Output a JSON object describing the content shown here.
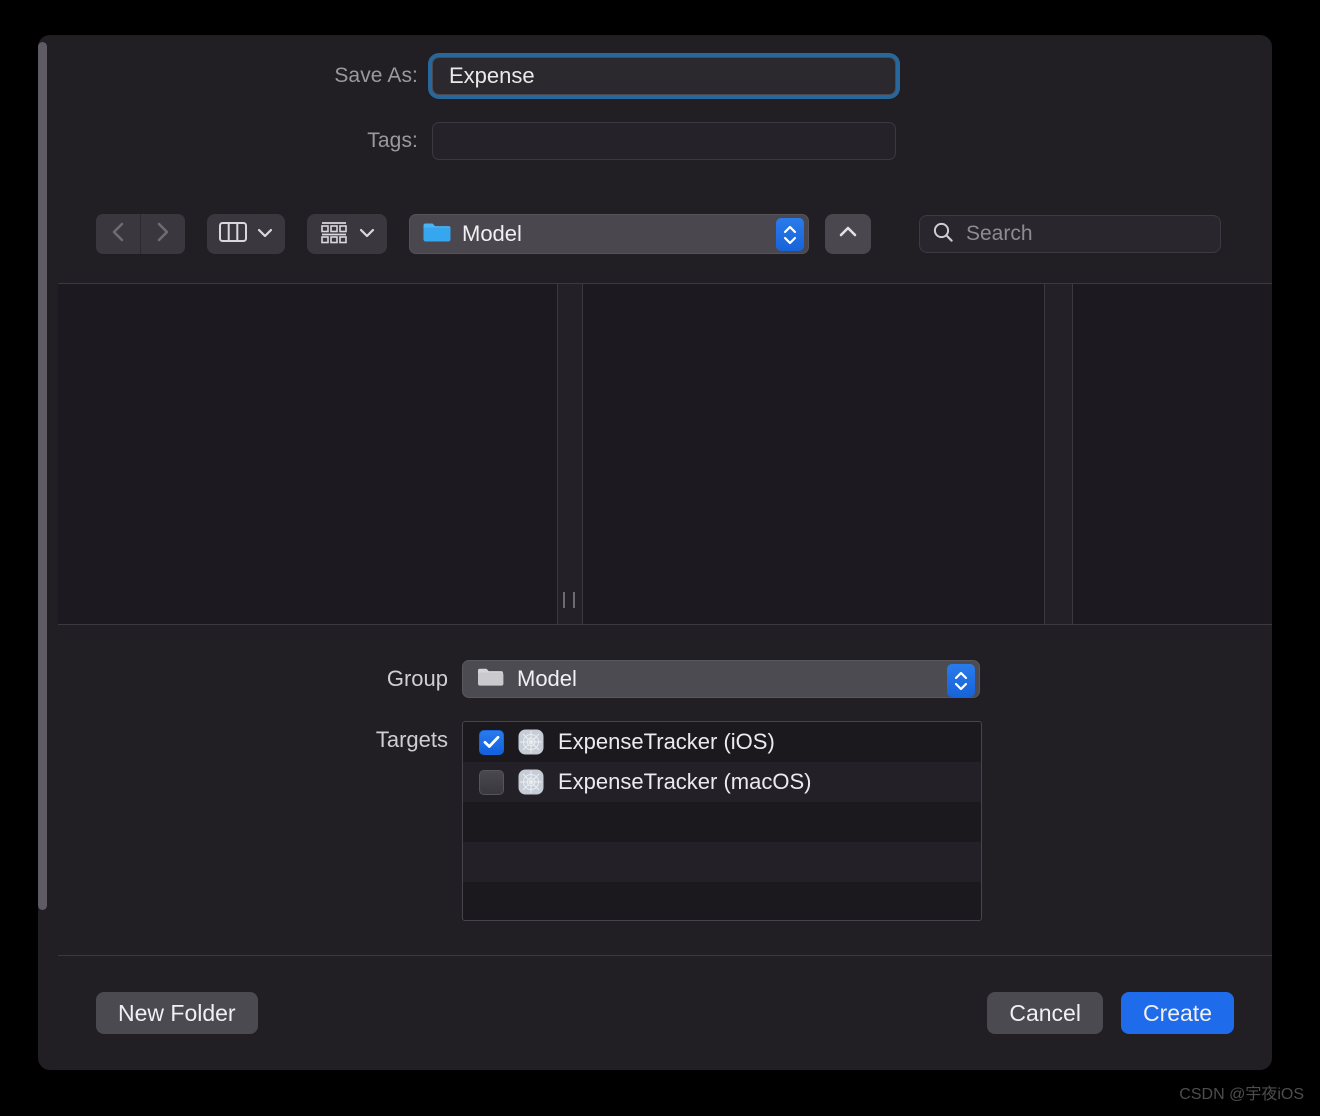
{
  "dialog": {
    "save_as_label": "Save As:",
    "save_as_value": "Expense",
    "tags_label": "Tags:",
    "tags_value": "",
    "tags_placeholder": ""
  },
  "toolbar": {
    "back_icon": "chevron-left-icon",
    "forward_icon": "chevron-right-icon",
    "column_view_icon": "column-view-icon",
    "gallery_view_icon": "gallery-view-icon",
    "path_label": "Model",
    "up_icon": "chevron-up-icon",
    "search_placeholder": "Search",
    "search_value": "",
    "search_icon": "search-icon"
  },
  "group": {
    "label": "Group",
    "value": "Model"
  },
  "targets": {
    "label": "Targets",
    "items": [
      {
        "name": "ExpenseTracker (iOS)",
        "checked": true
      },
      {
        "name": "ExpenseTracker (macOS)",
        "checked": false
      }
    ]
  },
  "footer": {
    "new_folder_label": "New Folder",
    "cancel_label": "Cancel",
    "create_label": "Create"
  },
  "watermark": "CSDN @宇夜iOS",
  "colors": {
    "accent_blue": "#1e6ceb",
    "focus_ring": "#286ca0",
    "dialog_bg": "#211f24",
    "browser_bg": "#1c1a20",
    "folder_blue": "#3aaef0"
  }
}
